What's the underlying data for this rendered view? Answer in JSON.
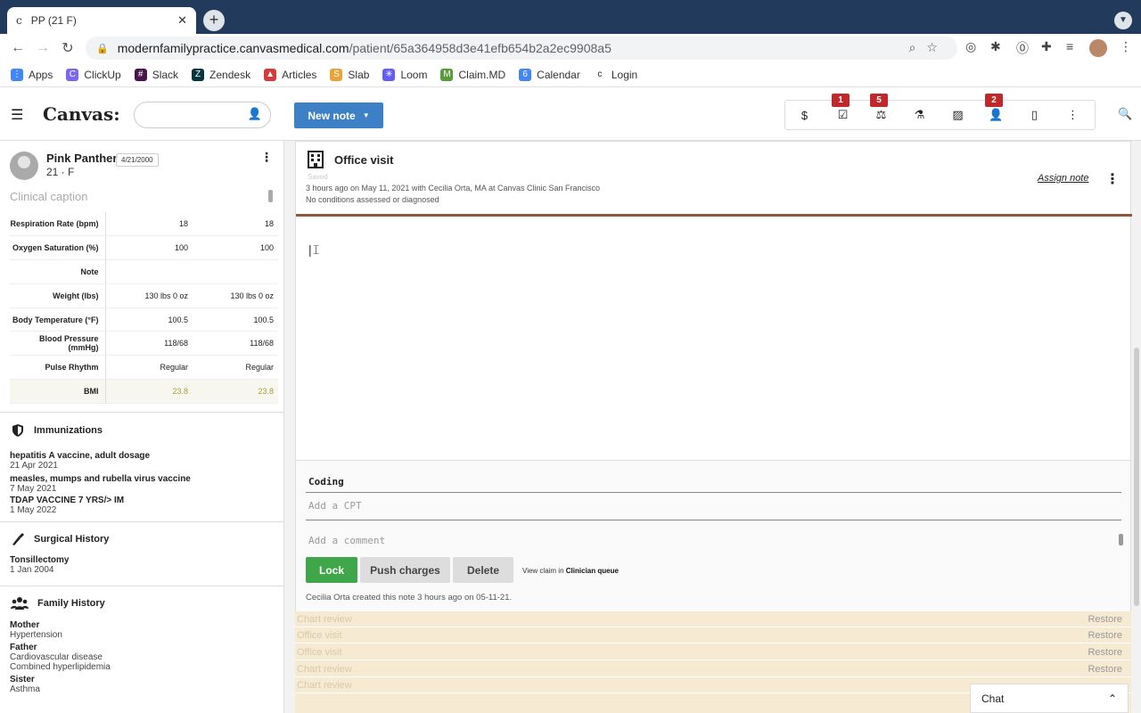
{
  "browser": {
    "tab_title": "PP (21 F)",
    "url_host": "modernfamilypractice.canvasmedical.com",
    "url_path": "/patient/65a364958d3e41efb654b2a2ec9908a5",
    "bookmarks": [
      {
        "label": "Apps",
        "color": "#4285f4"
      },
      {
        "label": "ClickUp",
        "color": "#7b68ee"
      },
      {
        "label": "Slack",
        "color": "#4a154b"
      },
      {
        "label": "Zendesk",
        "color": "#03363d"
      },
      {
        "label": "Articles",
        "color": "#d63b3b"
      },
      {
        "label": "Slab",
        "color": "#e8a33a"
      },
      {
        "label": "Loom",
        "color": "#625df5"
      },
      {
        "label": "Claim.MD",
        "color": "#5a9a3c"
      },
      {
        "label": "Calendar",
        "color": "#4285f4"
      },
      {
        "label": "Login",
        "color": "#222222"
      }
    ]
  },
  "header": {
    "logo": "Canvas:",
    "new_note_label": "New note",
    "badges": {
      "tasks": "1",
      "labs": "5",
      "patients": "2"
    }
  },
  "patient": {
    "name": "Pink Panther",
    "dob": "4/21/2000",
    "info": "21 · F",
    "caption_placeholder": "Clinical caption"
  },
  "vitals": [
    {
      "label": "Respiration Rate (bpm)",
      "v1": "18",
      "v2": "18"
    },
    {
      "label": "Oxygen Saturation (%)",
      "v1": "100",
      "v2": "100"
    },
    {
      "label": "Note",
      "v1": "",
      "v2": ""
    },
    {
      "label": "Weight (lbs)",
      "v1": "130 lbs 0 oz",
      "v2": "130 lbs 0 oz"
    },
    {
      "label": "Body Temperature (°F)",
      "v1": "100.5",
      "v2": "100.5"
    },
    {
      "label": "Blood Pressure (mmHg)",
      "v1": "118/68",
      "v2": "118/68"
    },
    {
      "label": "Pulse Rhythm",
      "v1": "Regular",
      "v2": "Regular"
    },
    {
      "label": "BMI",
      "v1": "23.8",
      "v2": "23.8"
    }
  ],
  "immunizations": {
    "title": "Immunizations",
    "items": [
      {
        "name": "hepatitis A vaccine, adult dosage",
        "date": "21 Apr 2021"
      },
      {
        "name": "measles, mumps and rubella virus vaccine",
        "date": "7 May 2021"
      },
      {
        "name": "TDAP VACCINE 7 YRS/> IM",
        "date": "1 May 2022"
      }
    ]
  },
  "surgical": {
    "title": "Surgical History",
    "items": [
      {
        "name": "Tonsillectomy",
        "date": "1 Jan 2004"
      }
    ]
  },
  "family": {
    "title": "Family History",
    "items": [
      {
        "name": "Mother",
        "detail": "Hypertension"
      },
      {
        "name": "Father",
        "detail": "Cardiovascular disease\nCombined hyperlipidemia"
      },
      {
        "name": "Sister",
        "detail": "Asthma"
      }
    ]
  },
  "note": {
    "title": "Office visit",
    "status": "Saved",
    "meta_line1": "3 hours ago on May 11, 2021 with Cecilia Orta, MA at Canvas Clinic San Francisco",
    "meta_line2": "No conditions assessed or diagnosed",
    "assign_label": "Assign note"
  },
  "coding": {
    "title": "Coding",
    "cpt_placeholder": "Add a CPT",
    "comment_placeholder": "Add a comment",
    "lock_label": "Lock",
    "push_label": "Push charges",
    "delete_label": "Delete",
    "claim_prefix": "View claim in",
    "claim_link": "Clinician queue",
    "created_text": "Cecilia Orta created this note 3 hours ago on 05-11-21."
  },
  "history": [
    {
      "label": "Chart review",
      "action": "Restore"
    },
    {
      "label": "Office visit",
      "action": "Restore"
    },
    {
      "label": "Office visit",
      "action": "Restore"
    },
    {
      "label": "Chart review",
      "action": "Restore"
    },
    {
      "label": "Chart review",
      "action": ""
    }
  ],
  "chat": {
    "label": "Chat"
  }
}
